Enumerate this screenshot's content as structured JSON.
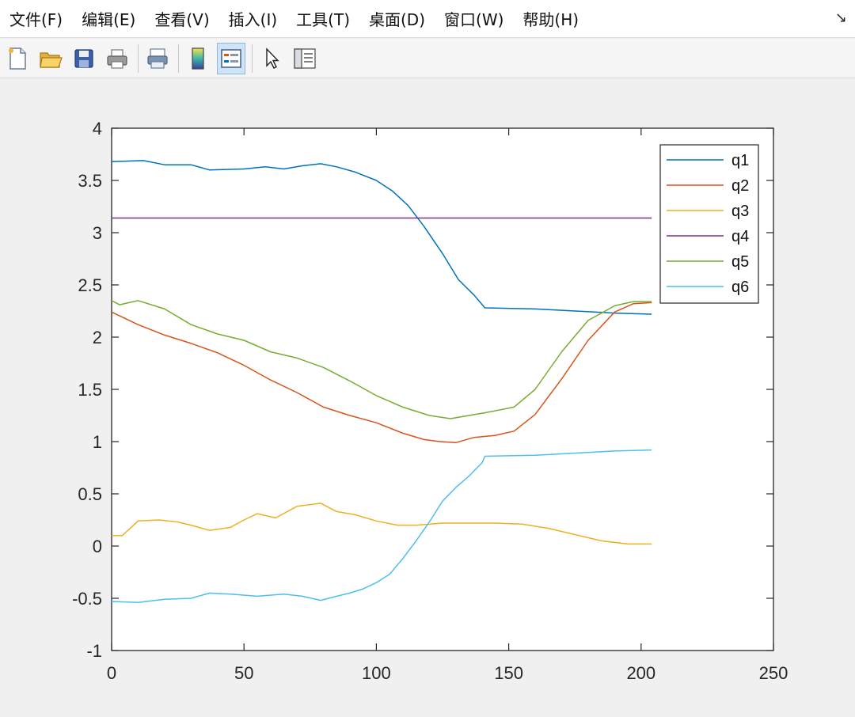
{
  "menu": {
    "items": [
      "文件(F)",
      "编辑(E)",
      "查看(V)",
      "插入(I)",
      "工具(T)",
      "桌面(D)",
      "窗口(W)",
      "帮助(H)"
    ],
    "arrow": "↘"
  },
  "toolbar": {
    "icons": [
      "new-file-icon",
      "open-folder-icon",
      "save-icon",
      "print-icon",
      "print-preview-icon",
      "colorbar-icon",
      "legend-icon",
      "select-pointer-icon",
      "property-inspector-icon"
    ],
    "active": "legend-icon"
  },
  "colors": {
    "q1": "#0072BD",
    "q2": "#D95319",
    "q3": "#EDB120",
    "q4": "#7E2F8E",
    "q5": "#77AC30",
    "q6": "#4DBEEE"
  },
  "chart_data": {
    "type": "line",
    "title": "",
    "xlabel": "",
    "ylabel": "",
    "xlim": [
      0,
      250
    ],
    "ylim": [
      -1,
      4
    ],
    "xticks": [
      "0",
      "50",
      "100",
      "150",
      "200",
      "250"
    ],
    "yticks": [
      "-1",
      "-0.5",
      "0",
      "0.5",
      "1",
      "1.5",
      "2",
      "2.5",
      "3",
      "3.5",
      "4"
    ],
    "grid": false,
    "legend_position": "top-right",
    "series": [
      {
        "name": "q1",
        "color": "#0072BD",
        "x": [
          0,
          12,
          20,
          30,
          37,
          50,
          58,
          65,
          72,
          79,
          85,
          92,
          100,
          106,
          112,
          118,
          125,
          131,
          137,
          141,
          160,
          190,
          204
        ],
        "y": [
          3.68,
          3.69,
          3.65,
          3.65,
          3.6,
          3.61,
          3.63,
          3.61,
          3.64,
          3.66,
          3.63,
          3.58,
          3.5,
          3.4,
          3.26,
          3.06,
          2.8,
          2.55,
          2.4,
          2.28,
          2.27,
          2.23,
          2.22
        ]
      },
      {
        "name": "q2",
        "color": "#D95319",
        "x": [
          0,
          10,
          20,
          30,
          40,
          50,
          60,
          70,
          80,
          90,
          100,
          110,
          118,
          124,
          130,
          137,
          145,
          152,
          160,
          170,
          180,
          190,
          197,
          204
        ],
        "y": [
          2.24,
          2.12,
          2.02,
          1.94,
          1.85,
          1.73,
          1.59,
          1.47,
          1.33,
          1.25,
          1.18,
          1.08,
          1.02,
          1.0,
          0.99,
          1.04,
          1.06,
          1.1,
          1.26,
          1.6,
          1.97,
          2.24,
          2.32,
          2.33
        ]
      },
      {
        "name": "q3",
        "color": "#EDB120",
        "x": [
          0,
          4,
          10,
          18,
          25,
          30,
          37,
          45,
          50,
          55,
          62,
          70,
          79,
          85,
          92,
          100,
          108,
          115,
          125,
          135,
          145,
          155,
          165,
          175,
          185,
          195,
          204
        ],
        "y": [
          0.1,
          0.1,
          0.24,
          0.25,
          0.23,
          0.2,
          0.15,
          0.18,
          0.25,
          0.31,
          0.27,
          0.38,
          0.41,
          0.33,
          0.3,
          0.24,
          0.2,
          0.2,
          0.22,
          0.22,
          0.22,
          0.21,
          0.17,
          0.11,
          0.05,
          0.02,
          0.02
        ]
      },
      {
        "name": "q4",
        "color": "#7E2F8E",
        "x": [
          0,
          204
        ],
        "y": [
          3.14,
          3.14
        ]
      },
      {
        "name": "q5",
        "color": "#77AC30",
        "x": [
          0,
          3,
          10,
          20,
          30,
          40,
          50,
          60,
          70,
          80,
          90,
          100,
          110,
          120,
          128,
          135,
          142,
          152,
          160,
          170,
          180,
          190,
          197,
          204
        ],
        "y": [
          2.35,
          2.31,
          2.35,
          2.27,
          2.12,
          2.03,
          1.97,
          1.86,
          1.8,
          1.71,
          1.58,
          1.44,
          1.33,
          1.25,
          1.22,
          1.25,
          1.28,
          1.33,
          1.5,
          1.86,
          2.16,
          2.3,
          2.34,
          2.34
        ]
      },
      {
        "name": "q6",
        "color": "#4DBEEE",
        "x": [
          0,
          10,
          20,
          30,
          37,
          45,
          55,
          65,
          72,
          79,
          85,
          90,
          95,
          100,
          105,
          110,
          115,
          120,
          125,
          130,
          135,
          140,
          141,
          160,
          190,
          204
        ],
        "y": [
          -0.53,
          -0.54,
          -0.51,
          -0.5,
          -0.45,
          -0.46,
          -0.48,
          -0.46,
          -0.48,
          -0.52,
          -0.48,
          -0.45,
          -0.41,
          -0.35,
          -0.27,
          -0.12,
          0.05,
          0.23,
          0.43,
          0.56,
          0.67,
          0.8,
          0.86,
          0.87,
          0.91,
          0.92
        ]
      }
    ]
  }
}
